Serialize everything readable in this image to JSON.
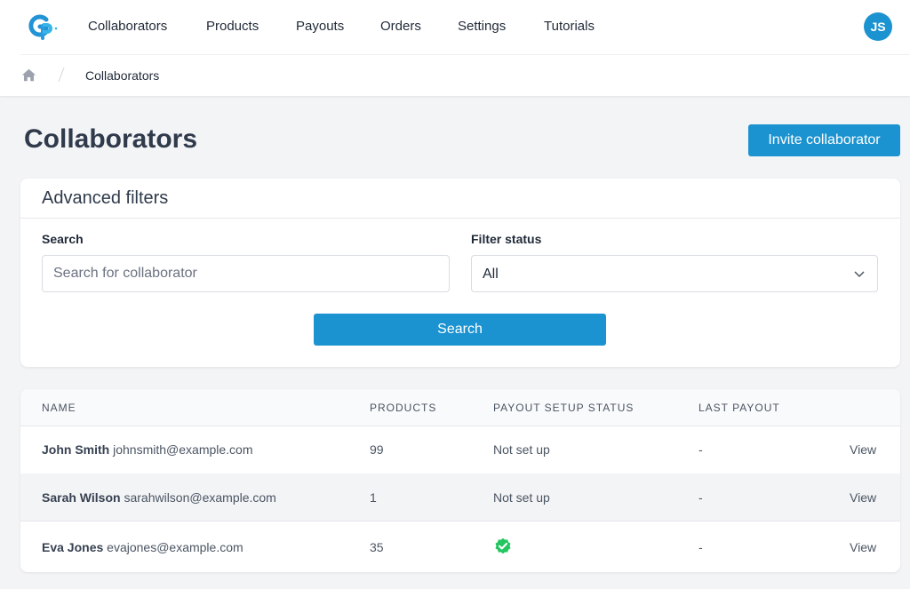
{
  "brand": {
    "logo_text": "GP",
    "accent": "#1b93d0",
    "success": "#22c55e"
  },
  "nav": {
    "items": [
      {
        "label": "Collaborators"
      },
      {
        "label": "Products"
      },
      {
        "label": "Payouts"
      },
      {
        "label": "Orders"
      },
      {
        "label": "Settings"
      },
      {
        "label": "Tutorials"
      }
    ],
    "avatar_initials": "JS"
  },
  "breadcrumb": {
    "home_icon": "home-icon",
    "current": "Collaborators"
  },
  "page": {
    "title": "Collaborators",
    "invite_button": "Invite collaborator"
  },
  "filters": {
    "title": "Advanced filters",
    "search_label": "Search",
    "search_placeholder": "Search for collaborator",
    "search_value": "",
    "status_label": "Filter status",
    "status_value": "All",
    "search_button": "Search"
  },
  "table": {
    "columns": [
      "NAME",
      "PRODUCTS",
      "PAYOUT SETUP STATUS",
      "LAST PAYOUT"
    ],
    "rows": [
      {
        "name": "John Smith",
        "email": "johnsmith@example.com",
        "products": "99",
        "payout_status": "Not set up",
        "payout_status_icon": null,
        "last_payout": "-",
        "action": "View"
      },
      {
        "name": "Sarah Wilson",
        "email": "sarahwilson@example.com",
        "products": "1",
        "payout_status": "Not set up",
        "payout_status_icon": null,
        "last_payout": "-",
        "action": "View"
      },
      {
        "name": "Eva Jones",
        "email": "evajones@example.com",
        "products": "35",
        "payout_status": "",
        "payout_status_icon": "verified-check-icon",
        "last_payout": "-",
        "action": "View"
      }
    ]
  }
}
